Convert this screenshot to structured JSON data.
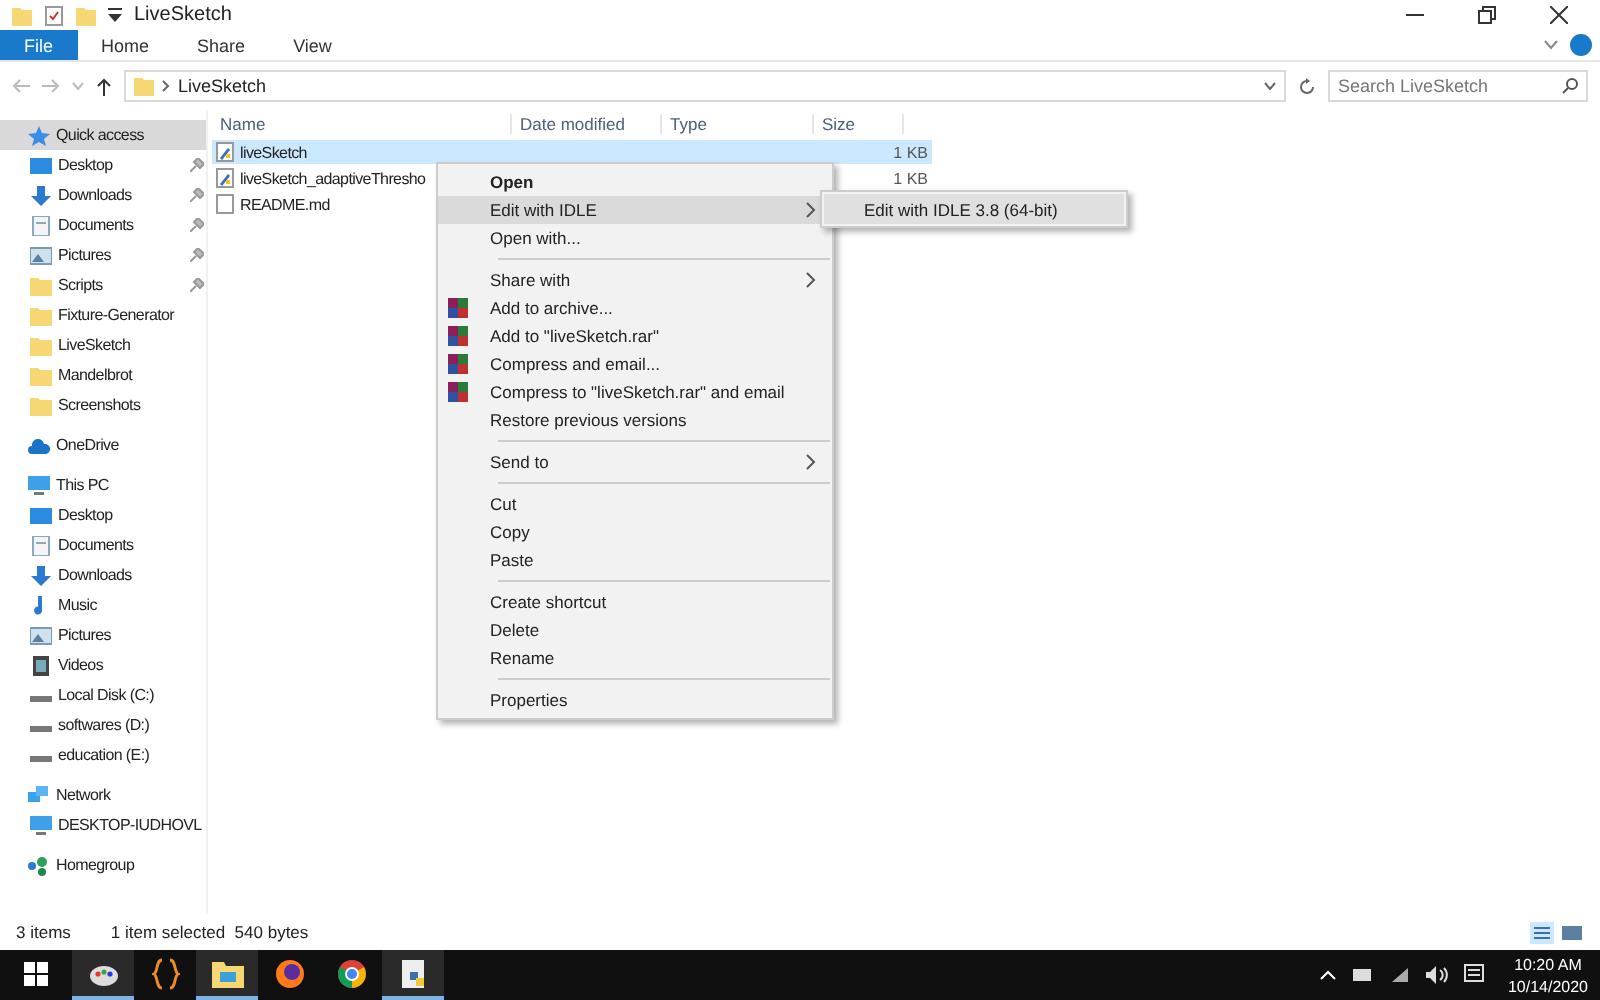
{
  "window": {
    "title": "LiveSketch"
  },
  "ribbon_tabs": [
    {
      "label": "File",
      "selected": true
    },
    {
      "label": "Home",
      "selected": false
    },
    {
      "label": "Share",
      "selected": false
    },
    {
      "label": "View",
      "selected": false
    }
  ],
  "address": {
    "path": "LiveSketch",
    "search_placeholder": "Search LiveSketch"
  },
  "nav": [
    {
      "label": "Quick access",
      "kind": "star",
      "selected": true,
      "children": [
        {
          "label": "Desktop",
          "kind": "desktop",
          "pinned": true
        },
        {
          "label": "Downloads",
          "kind": "download",
          "pinned": true
        },
        {
          "label": "Documents",
          "kind": "document",
          "pinned": true
        },
        {
          "label": "Pictures",
          "kind": "pictures",
          "pinned": true
        },
        {
          "label": "Scripts",
          "kind": "folder",
          "pinned": true
        },
        {
          "label": "Fixture-Generator",
          "kind": "folder",
          "pinned": false
        },
        {
          "label": "LiveSketch",
          "kind": "folder",
          "pinned": false
        },
        {
          "label": "Mandelbrot",
          "kind": "folder",
          "pinned": false
        },
        {
          "label": "Screenshots",
          "kind": "folder",
          "pinned": false
        }
      ]
    },
    {
      "label": "OneDrive",
      "kind": "cloud",
      "selected": false
    },
    {
      "label": "This PC",
      "kind": "pc",
      "selected": false,
      "children": [
        {
          "label": "Desktop",
          "kind": "desktop",
          "pinned": false
        },
        {
          "label": "Documents",
          "kind": "document",
          "pinned": false
        },
        {
          "label": "Downloads",
          "kind": "download",
          "pinned": false
        },
        {
          "label": "Music",
          "kind": "music",
          "pinned": false
        },
        {
          "label": "Pictures",
          "kind": "pictures",
          "pinned": false
        },
        {
          "label": "Videos",
          "kind": "video",
          "pinned": false
        },
        {
          "label": "Local Disk (C:)",
          "kind": "drive",
          "pinned": false
        },
        {
          "label": "softwares (D:)",
          "kind": "drive",
          "pinned": false
        },
        {
          "label": "education (E:)",
          "kind": "drive",
          "pinned": false
        }
      ]
    },
    {
      "label": "Network",
      "kind": "network",
      "selected": false,
      "children": [
        {
          "label": "DESKTOP-IUDHOVL",
          "kind": "pc",
          "pinned": false
        }
      ]
    },
    {
      "label": "Homegroup",
      "kind": "homegroup",
      "selected": false
    }
  ],
  "columns": [
    "Name",
    "Date modified",
    "Type",
    "Size"
  ],
  "files": [
    {
      "name": "liveSketch",
      "kind": "python",
      "size": "1 KB",
      "selected": true
    },
    {
      "name": "liveSketch_adaptiveThresho",
      "kind": "python",
      "size": "1 KB",
      "selected": false
    },
    {
      "name": "README.md",
      "kind": "text",
      "selected": false
    }
  ],
  "context_menu": [
    [
      {
        "label": "Open",
        "kind": "plain",
        "default": true,
        "submenu": false,
        "selected": false
      },
      {
        "label": "Edit with IDLE",
        "kind": "plain",
        "default": false,
        "submenu": true,
        "selected": true
      },
      {
        "label": "Open with...",
        "kind": "plain",
        "default": false,
        "submenu": false,
        "selected": false
      }
    ],
    [
      {
        "label": "Share with",
        "kind": "plain",
        "default": false,
        "submenu": true,
        "selected": false
      },
      {
        "label": "Add to archive...",
        "kind": "archive",
        "default": false,
        "submenu": false,
        "selected": false
      },
      {
        "label": "Add to \"liveSketch.rar\"",
        "kind": "archive",
        "default": false,
        "submenu": false,
        "selected": false
      },
      {
        "label": "Compress and email...",
        "kind": "archive",
        "default": false,
        "submenu": false,
        "selected": false
      },
      {
        "label": "Compress to \"liveSketch.rar\" and email",
        "kind": "archive",
        "default": false,
        "submenu": false,
        "selected": false
      },
      {
        "label": "Restore previous versions",
        "kind": "plain",
        "default": false,
        "submenu": false,
        "selected": false
      }
    ],
    [
      {
        "label": "Send to",
        "kind": "plain",
        "default": false,
        "submenu": true,
        "selected": false
      }
    ],
    [
      {
        "label": "Cut",
        "kind": "plain",
        "default": false,
        "submenu": false,
        "selected": false
      },
      {
        "label": "Copy",
        "kind": "plain",
        "default": false,
        "submenu": false,
        "selected": false
      },
      {
        "label": "Paste",
        "kind": "plain",
        "default": false,
        "submenu": false,
        "selected": false
      }
    ],
    [
      {
        "label": "Create shortcut",
        "kind": "plain",
        "default": false,
        "submenu": false,
        "selected": false
      },
      {
        "label": "Delete",
        "kind": "plain",
        "default": false,
        "submenu": false,
        "selected": false
      },
      {
        "label": "Rename",
        "kind": "plain",
        "default": false,
        "submenu": false,
        "selected": false
      }
    ],
    [
      {
        "label": "Properties",
        "kind": "plain",
        "default": false,
        "submenu": false,
        "selected": false
      }
    ]
  ],
  "submenu": [
    "Edit with IDLE 3.8 (64-bit)"
  ],
  "status_bar": {
    "count": "3 items",
    "selection": "1 item selected  540 bytes"
  },
  "taskbar": {
    "apps": [
      {
        "kind": "paint",
        "active": true
      },
      {
        "kind": "brackets",
        "active": false
      },
      {
        "kind": "explorer",
        "active": true
      },
      {
        "kind": "firefox",
        "active": false
      },
      {
        "kind": "chrome",
        "active": false
      },
      {
        "kind": "python",
        "active": true
      }
    ],
    "time": "10:20 AM",
    "date": "10/14/2020"
  }
}
